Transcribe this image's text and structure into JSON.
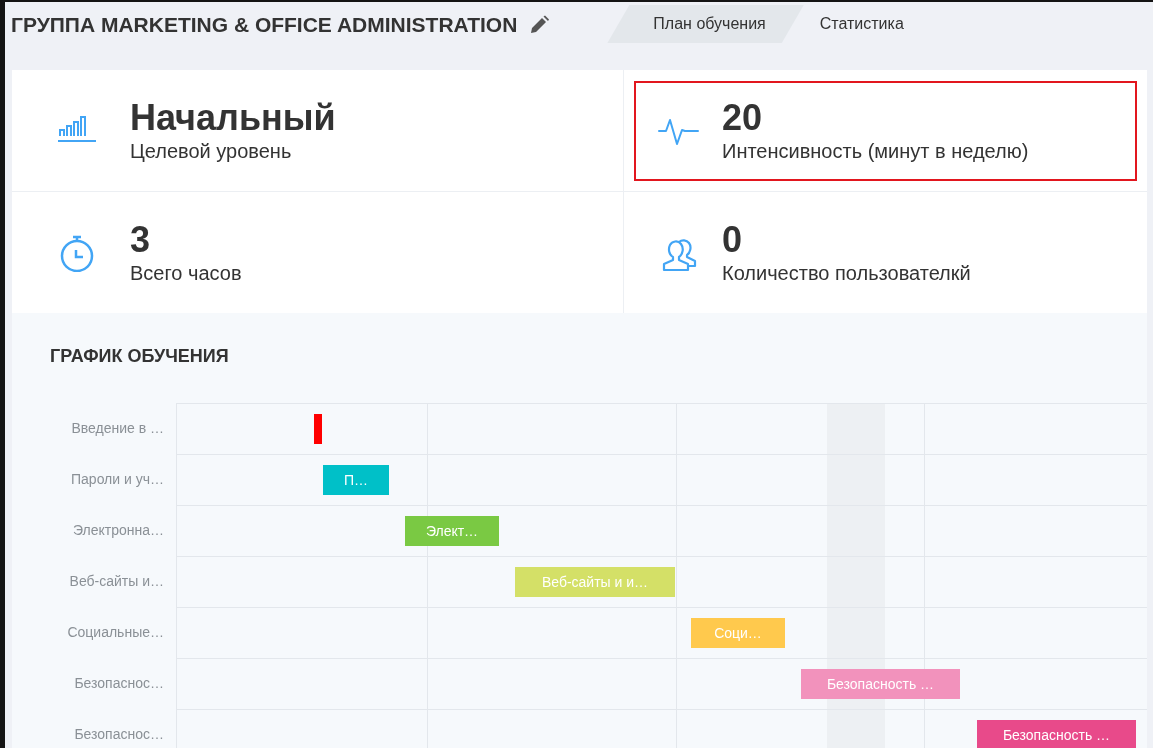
{
  "header": {
    "title": "ГРУППА MARKETING & OFFICE ADMINISTRATION"
  },
  "tabs": [
    {
      "label": "План обучения",
      "selected": true
    },
    {
      "label": "Статистика",
      "selected": false
    }
  ],
  "stats": [
    {
      "kind": "level",
      "value": "Начальный",
      "label": "Целевой уровень",
      "highlighted": false
    },
    {
      "kind": "pulse",
      "value": "20",
      "label": "Интенсивность (минут в неделю)",
      "highlighted": true
    },
    {
      "kind": "timer",
      "value": "3",
      "label": "Всего часов",
      "highlighted": false
    },
    {
      "kind": "users",
      "value": "0",
      "label": "Количество пользователкй",
      "highlighted": false
    }
  ],
  "schedule": {
    "title": "ГРАФИК ОБУЧЕНИЯ",
    "rows": [
      {
        "label": "Введение в …",
        "color": "#ff0000"
      },
      {
        "label": "Пароли и уч…",
        "bar_label": "П…",
        "color": "#00c0c8"
      },
      {
        "label": "Электронна…",
        "bar_label": "Элект…",
        "color": "#7ac943"
      },
      {
        "label": "Веб-сайты и…",
        "bar_label": "Веб-сайты и и…",
        "color": "#d4e067"
      },
      {
        "label": "Социальные…",
        "bar_label": "Соци…",
        "color": "#ffc94d"
      },
      {
        "label": "Безопаснос…",
        "bar_label": "Безопасность …",
        "color": "#f292bc"
      },
      {
        "label": "Безопаснос…",
        "bar_label": "Безопасность …",
        "color": "#e84a8a"
      }
    ]
  }
}
